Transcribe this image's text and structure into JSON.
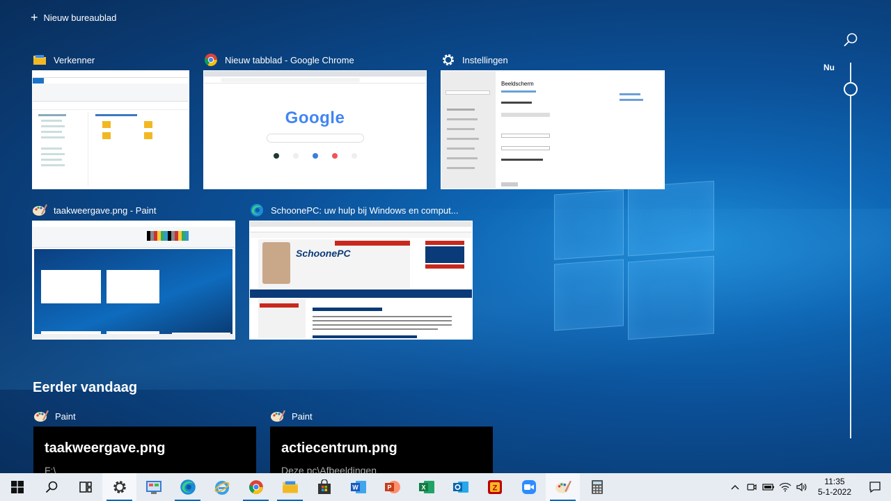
{
  "header": {
    "new_desktop_label": "Nieuw bureaublad"
  },
  "windows": [
    {
      "title": "Verkenner",
      "icon": "folder-icon"
    },
    {
      "title": "Nieuw tabblad - Google Chrome",
      "icon": "chrome-icon",
      "content": "Google"
    },
    {
      "title": "Instellingen",
      "icon": "gear-icon",
      "content": "Beeldscherm"
    },
    {
      "title": "taakweergave.png - Paint",
      "icon": "paint-icon"
    },
    {
      "title": "SchoonePC: uw hulp bij Windows en comput...",
      "icon": "edge-icon",
      "content": "SchoonePC"
    }
  ],
  "timeline": {
    "now_label": "Nu"
  },
  "earlier": {
    "heading": "Eerder vandaag",
    "items": [
      {
        "app": "Paint",
        "title": "taakweergave.png",
        "path": "F:\\"
      },
      {
        "app": "Paint",
        "title": "actiecentrum.png",
        "path": "Deze pc\\Afbeeldingen"
      }
    ]
  },
  "taskbar": {
    "apps": [
      "start-icon",
      "search-icon",
      "task-view-icon",
      "settings-icon",
      "control-panel-icon",
      "edge-icon",
      "internet-explorer-icon",
      "chrome-icon",
      "file-explorer-icon",
      "store-icon",
      "word-icon",
      "powerpoint-icon",
      "excel-icon",
      "outlook-icon",
      "filezilla-icon",
      "zoom-icon",
      "paint-icon",
      "calculator-icon"
    ],
    "time": "11:35",
    "date": "5-1-2022"
  },
  "colors": {
    "accent": "#0067c0",
    "taskbar": "#e6ecf2"
  }
}
